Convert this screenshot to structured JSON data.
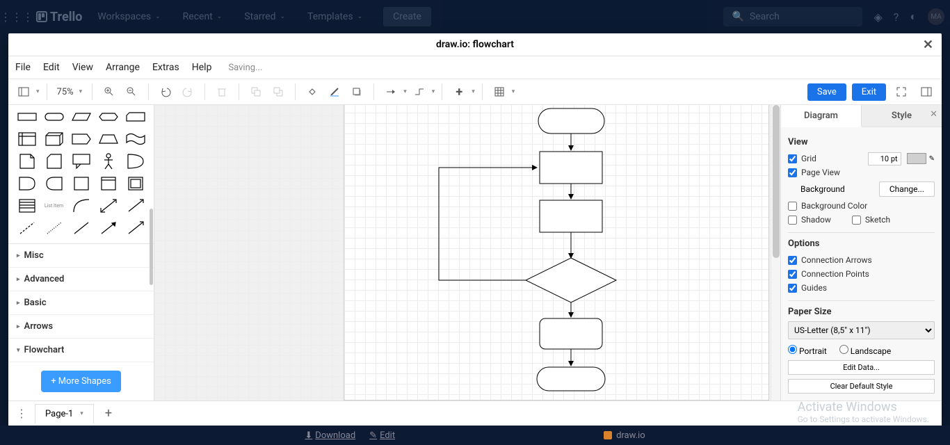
{
  "trello": {
    "brand": "Trello",
    "nav": [
      "Workspaces",
      "Recent",
      "Starred",
      "Templates"
    ],
    "create": "Create",
    "search_placeholder": "Search",
    "avatar": "MA"
  },
  "modal_title": "draw.io: flowchart",
  "menubar": {
    "items": [
      "File",
      "Edit",
      "View",
      "Arrange",
      "Extras",
      "Help"
    ],
    "status": "Saving..."
  },
  "toolbar": {
    "zoom": "75%",
    "save": "Save",
    "exit": "Exit"
  },
  "sidebar": {
    "sections": [
      "Misc",
      "Advanced",
      "Basic",
      "Arrows",
      "Flowchart"
    ],
    "more_shapes": "+ More Shapes"
  },
  "format": {
    "tabs": [
      "Diagram",
      "Style"
    ],
    "view_heading": "View",
    "grid_label": "Grid",
    "grid_value": "10 pt",
    "page_view": "Page View",
    "background_label": "Background",
    "change": "Change...",
    "background_color": "Background Color",
    "shadow": "Shadow",
    "sketch": "Sketch",
    "options_heading": "Options",
    "conn_arrows": "Connection Arrows",
    "conn_points": "Connection Points",
    "guides": "Guides",
    "paper_heading": "Paper Size",
    "paper_value": "US-Letter (8,5\" x 11\")",
    "portrait": "Portrait",
    "landscape": "Landscape",
    "edit_data": "Edit Data...",
    "clear_style": "Clear Default Style"
  },
  "footer": {
    "page": "Page-1"
  },
  "bg_bar": {
    "download": "Download",
    "edit": "Edit",
    "app": "draw.io"
  },
  "watermark": {
    "l1": "Activate Windows",
    "l2": "Go to Settings to activate Windows."
  }
}
